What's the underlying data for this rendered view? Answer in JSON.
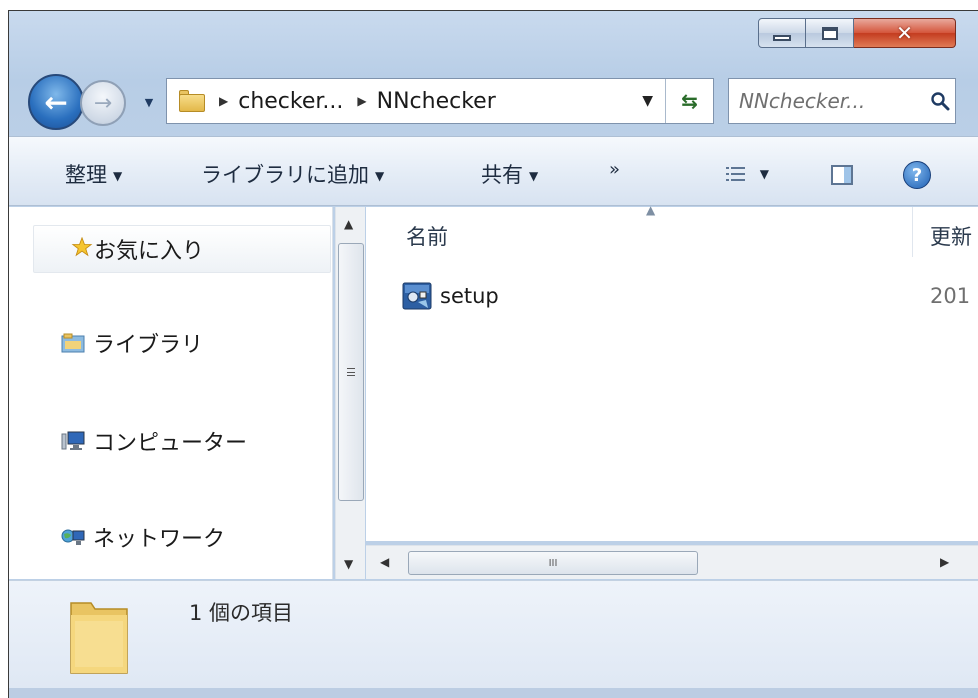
{
  "window": {
    "caption_buttons": {
      "minimize_icon": "minimize-icon",
      "maximize_icon": "maximize-icon",
      "close_glyph": "✕"
    }
  },
  "nav": {
    "back_glyph": "←",
    "forward_glyph": "→",
    "history_glyph": "▼",
    "breadcrumbs": [
      "checker...",
      "NNchecker"
    ],
    "separator_glyph": "▶",
    "dropdown_glyph": "▼",
    "refresh_glyph": "⇆",
    "search_placeholder": "NNchecker..."
  },
  "toolbar": {
    "organize": "整理",
    "add_to_library": "ライブラリに追加",
    "share": "共有",
    "more": "»",
    "caret": "▼",
    "help": "?"
  },
  "sidebar": {
    "items": [
      {
        "label": "お気に入り",
        "icon": "star-icon"
      },
      {
        "label": "ライブラリ",
        "icon": "library-icon"
      },
      {
        "label": "コンピューター",
        "icon": "computer-icon"
      },
      {
        "label": "ネットワーク",
        "icon": "network-icon"
      }
    ],
    "scroll_up": "▲",
    "scroll_down": "▼"
  },
  "file_list": {
    "columns": {
      "name": "名前",
      "modified": "更新"
    },
    "sort_glyph": "▲",
    "rows": [
      {
        "name": "setup",
        "date": "201",
        "icon": "installer-icon"
      }
    ],
    "scroll_left": "◀",
    "scroll_right": "▶",
    "thumb_grip": "III"
  },
  "details": {
    "count_text": "1 個の項目",
    "icon": "folder-icon"
  },
  "colors": {
    "frame": "#bcd0e7",
    "command_bar": "#e4ecf6",
    "close_red": "#c43c1f",
    "accent_blue": "#2a6fbe"
  }
}
